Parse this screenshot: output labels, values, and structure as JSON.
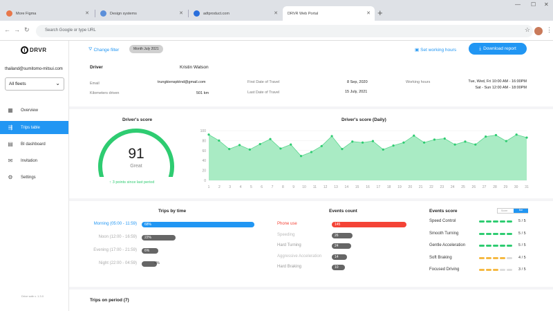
{
  "browser": {
    "tabs": [
      {
        "title": "More Figma",
        "color": "#e8774a"
      },
      {
        "title": "Design systems",
        "color": "#5b8fd9"
      },
      {
        "title": "adtproduct.com",
        "color": "#2a6fdc"
      },
      {
        "title": "DRVR Web Portal",
        "color": "#ffffff"
      }
    ],
    "omnibox_placeholder": "Search Google or type URL"
  },
  "sidebar": {
    "brand": "DRVR",
    "email": "thailand@sumitomo-mitsui.com",
    "fleet_select": "All fleets",
    "nav": [
      {
        "label": "Overview",
        "icon": "grid-icon"
      },
      {
        "label": "Trips table",
        "icon": "car-icon"
      },
      {
        "label": "BI dashboard",
        "icon": "dashboard-icon"
      },
      {
        "label": "Invitation",
        "icon": "mail-icon"
      },
      {
        "label": "Settings",
        "icon": "gear-icon"
      }
    ],
    "version": "Drive safe v. 1.3.0"
  },
  "toolbar": {
    "change_filter": "Change filter",
    "month_chip": "Month July 2021",
    "working_hours": "Set working hours",
    "download": "Download report"
  },
  "driver": {
    "heading": "Driver",
    "name": "Kristin Watson",
    "email_label": "Email",
    "email": "trungkienspktnd@gmail.com",
    "km_label": "Kilometers driven",
    "km": "501 km",
    "first_label": "First Date of Travel",
    "first": "8 Sep, 2020",
    "last_label": "Last Date of Travel",
    "last": "15 July, 2021",
    "hours_label": "Working hours",
    "hours_1": "Tue, Wed, Fri  10:00 AM - 16:00PM",
    "hours_2": "Sat - Sun  12:00 AM - 18:00PM"
  },
  "score": {
    "title": "Driver's score",
    "value": "91",
    "grade": "Great",
    "delta": "3 points since last period",
    "fraction": 0.91
  },
  "chart_data": {
    "type": "area",
    "title": "Driver's score (Daily)",
    "x": [
      1,
      2,
      3,
      4,
      5,
      6,
      7,
      8,
      9,
      10,
      11,
      12,
      13,
      14,
      15,
      16,
      17,
      18,
      19,
      20,
      21,
      22,
      23,
      24,
      25,
      26,
      27,
      28,
      29,
      30,
      31
    ],
    "values": [
      92,
      80,
      63,
      71,
      62,
      73,
      83,
      64,
      72,
      49,
      57,
      69,
      89,
      63,
      78,
      76,
      79,
      62,
      70,
      76,
      90,
      76,
      82,
      84,
      72,
      78,
      72,
      88,
      91,
      79,
      92,
      86
    ],
    "ylim": [
      0,
      100
    ],
    "yticks": [
      0,
      20,
      40,
      60,
      80,
      100
    ],
    "color": "#58d68d"
  },
  "trips_by_time": {
    "title": "Trips by time",
    "rows": [
      {
        "label": "Morning (05:00 - 11:59)",
        "value": "68%",
        "pct": 0.68,
        "color": "#2196f3",
        "label_color": "#2196f3"
      },
      {
        "label": "Noon (12:00 - 16:59)",
        "value": "22%",
        "pct": 0.22,
        "color": "#666666",
        "label_color": "#aaaaaa"
      },
      {
        "label": "Evening (17:00 - 21:59)",
        "value": "6%",
        "pct": 0.06,
        "color": "#666666",
        "label_color": "#aaaaaa"
      },
      {
        "label": "Night (22:00 - 04:59)",
        "value": "4%",
        "pct": 0.04,
        "color": "#666666",
        "label_color": "#aaaaaa"
      }
    ]
  },
  "events_count": {
    "title": "Events count",
    "rows": [
      {
        "label": "Phone use",
        "value": "145",
        "pct": 1.0,
        "color": "#f44336",
        "label_color": "#f44336"
      },
      {
        "label": "Speeding",
        "value": "26",
        "pct": 0.28,
        "color": "#666666",
        "label_color": "#bbbbbb"
      },
      {
        "label": "Hard Turning",
        "value": "24",
        "pct": 0.26,
        "color": "#666666",
        "label_color": "#999999"
      },
      {
        "label": "Aggressive Acceleration",
        "value": "14",
        "pct": 0.2,
        "color": "#666666",
        "label_color": "#bbbbbb"
      },
      {
        "label": "Hard Braking",
        "value": "10",
        "pct": 0.18,
        "color": "#666666",
        "label_color": "#999999"
      }
    ]
  },
  "events_score": {
    "title": "Events score",
    "toggle_a": "Score",
    "toggle_b": "Bar",
    "rows": [
      {
        "label": "Speed Control",
        "score": "5 / 5",
        "filled": 5,
        "color": "#2ecc71"
      },
      {
        "label": "Smooth Turning",
        "score": "5 / 5",
        "filled": 5,
        "color": "#2ecc71"
      },
      {
        "label": "Gentle Acceleration",
        "score": "5 / 5",
        "filled": 5,
        "color": "#2ecc71"
      },
      {
        "label": "Soft Braking",
        "score": "4 / 5",
        "filled": 4,
        "color": "#f5b942"
      },
      {
        "label": "Focused Driving",
        "score": "3 / 5",
        "filled": 3,
        "color": "#f5b942"
      }
    ]
  },
  "trips_period": {
    "title": "Trips on period (7)"
  }
}
